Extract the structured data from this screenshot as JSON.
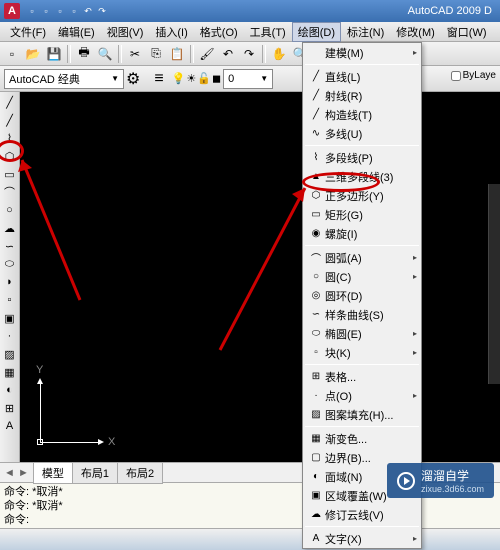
{
  "app": {
    "title": "AutoCAD 2009 D",
    "logo": "A"
  },
  "menubar": {
    "items": [
      "文件(F)",
      "编辑(E)",
      "视图(V)",
      "插入(I)",
      "格式(O)",
      "工具(T)",
      "绘图(D)",
      "标注(N)",
      "修改(M)",
      "窗口(W)"
    ],
    "active_index": 6
  },
  "workspace_combo": "AutoCAD 经典",
  "layer_combo": "0",
  "bylayer_label": "ByLaye",
  "dropdown": {
    "top": {
      "label": "建模(M)",
      "arrow": "▸"
    },
    "group1": [
      {
        "icon": "╱",
        "label": "直线(L)"
      },
      {
        "icon": "╱",
        "label": "射线(R)"
      },
      {
        "icon": "╱",
        "label": "构造线(T)"
      },
      {
        "icon": "∿",
        "label": "多线(U)"
      }
    ],
    "group2": [
      {
        "icon": "⌇",
        "label": "多段线(P)"
      },
      {
        "icon": "▲",
        "label": "三维多段线(3)"
      },
      {
        "icon": "⬡",
        "label": "正多边形(Y)"
      },
      {
        "icon": "▭",
        "label": "矩形(G)",
        "highlight": true
      },
      {
        "icon": "◉",
        "label": "螺旋(I)"
      }
    ],
    "group3": [
      {
        "icon": "⌒",
        "label": "圆弧(A)",
        "arrow": "▸"
      },
      {
        "icon": "○",
        "label": "圆(C)",
        "arrow": "▸"
      },
      {
        "icon": "◎",
        "label": "圆环(D)"
      },
      {
        "icon": "∽",
        "label": "样条曲线(S)"
      },
      {
        "icon": "⬭",
        "label": "椭圆(E)",
        "arrow": "▸"
      },
      {
        "icon": "▫",
        "label": "块(K)",
        "arrow": "▸"
      }
    ],
    "group4": [
      {
        "icon": "⊞",
        "label": "表格..."
      },
      {
        "icon": "·",
        "label": "点(O)",
        "arrow": "▸"
      },
      {
        "icon": "▨",
        "label": "图案填充(H)..."
      }
    ],
    "group5": [
      {
        "icon": "▦",
        "label": "渐变色..."
      },
      {
        "icon": "▢",
        "label": "边界(B)..."
      },
      {
        "icon": "◐",
        "label": "面域(N)"
      },
      {
        "icon": "▣",
        "label": "区域覆盖(W)"
      },
      {
        "icon": "☁",
        "label": "修订云线(V)"
      }
    ],
    "group6": [
      {
        "icon": "A",
        "label": "文字(X)",
        "arrow": "▸"
      }
    ]
  },
  "ucs": {
    "x": "X",
    "y": "Y"
  },
  "tabs": {
    "nav": "◄ ►",
    "items": [
      "模型",
      "布局1",
      "布局2"
    ],
    "active": 0
  },
  "command": {
    "lines": [
      "命令: *取消*",
      "命令: *取消*",
      "命令:"
    ]
  },
  "watermark": {
    "name": "溜溜自学",
    "sub": "zixue.3d66.com"
  }
}
